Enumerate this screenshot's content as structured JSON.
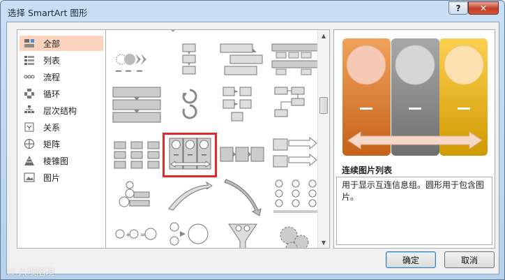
{
  "window": {
    "title": "选择 SmartArt 图形",
    "help_glyph": "?",
    "close_glyph": "✕"
  },
  "categories": [
    {
      "label": "全部",
      "icon": "all-grid-icon",
      "selected": true
    },
    {
      "label": "列表",
      "icon": "list-icon",
      "selected": false
    },
    {
      "label": "流程",
      "icon": "process-icon",
      "selected": false
    },
    {
      "label": "循环",
      "icon": "cycle-icon",
      "selected": false
    },
    {
      "label": "层次结构",
      "icon": "hierarchy-icon",
      "selected": false
    },
    {
      "label": "关系",
      "icon": "relationship-icon",
      "selected": false
    },
    {
      "label": "矩阵",
      "icon": "matrix-icon",
      "selected": false
    },
    {
      "label": "棱锥图",
      "icon": "pyramid-icon",
      "selected": false
    },
    {
      "label": "图片",
      "icon": "picture-icon",
      "selected": false
    }
  ],
  "gallery": {
    "selected_item": "continuous-picture-list"
  },
  "preview": {
    "name": "连续图片列表",
    "description": "用于显示互连信息组。圆形用于包含图片。",
    "colors": {
      "orange": "#e8822e",
      "gray": "#8c8c8c",
      "gold": "#f0b400"
    }
  },
  "buttons": {
    "ok": "确定",
    "cancel": "取消"
  },
  "watermark": "© 六坝陷境"
}
